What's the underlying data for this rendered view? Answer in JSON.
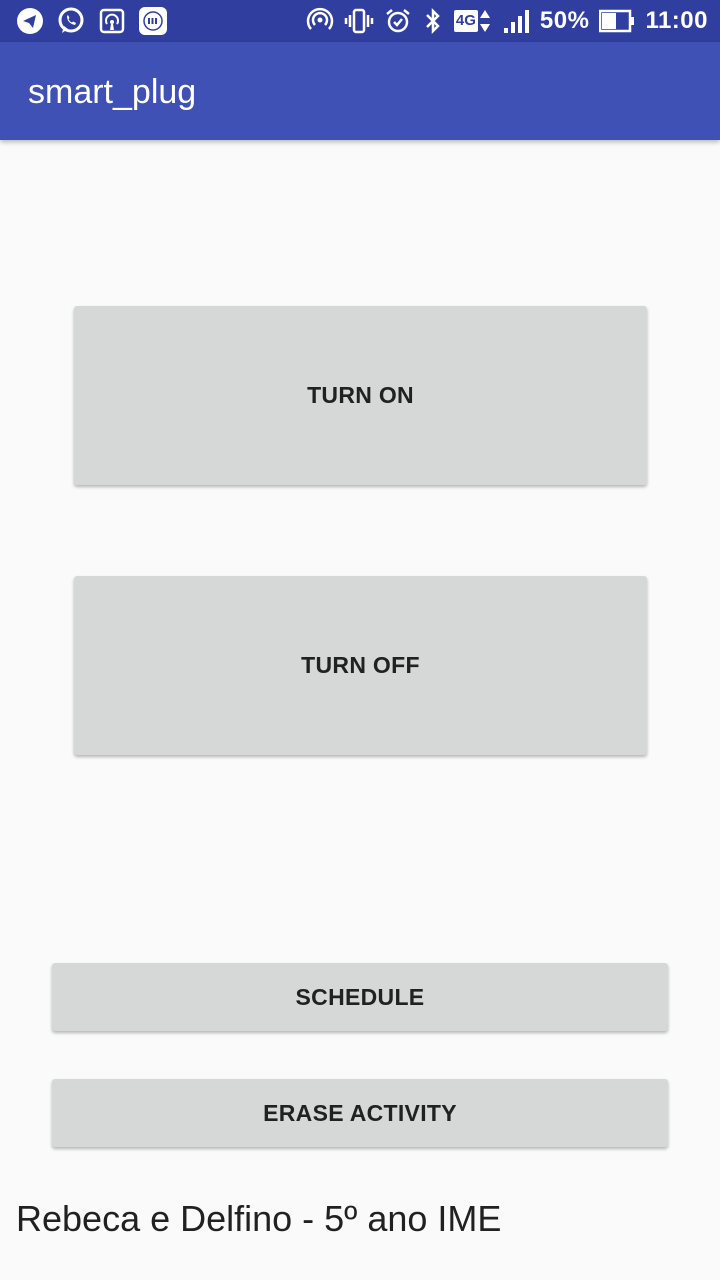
{
  "status_bar": {
    "left_icons": [
      "telegram-icon",
      "whatsapp-icon",
      "hotspot-icon",
      "mi-icon"
    ],
    "right_icons": [
      "hotspot-icon",
      "vibrate-icon",
      "alarm-icon",
      "bluetooth-icon",
      "4g-icon",
      "signal-icon",
      "battery-icon"
    ],
    "network": "4G",
    "battery": "50%",
    "time": "11:00"
  },
  "app_bar": {
    "title": "smart_plug"
  },
  "buttons": {
    "turn_on": "TURN ON",
    "turn_off": "TURN OFF",
    "schedule": "SCHEDULE",
    "erase_activity": "ERASE ACTIVITY"
  },
  "footer": {
    "text": "Rebeca e Delfino - 5º ano IME"
  },
  "colors": {
    "status_bar": "#303f9f",
    "app_bar": "#3f51b5",
    "background": "#fafafa",
    "button": "#d6d7d7",
    "button_text": "#212121"
  }
}
